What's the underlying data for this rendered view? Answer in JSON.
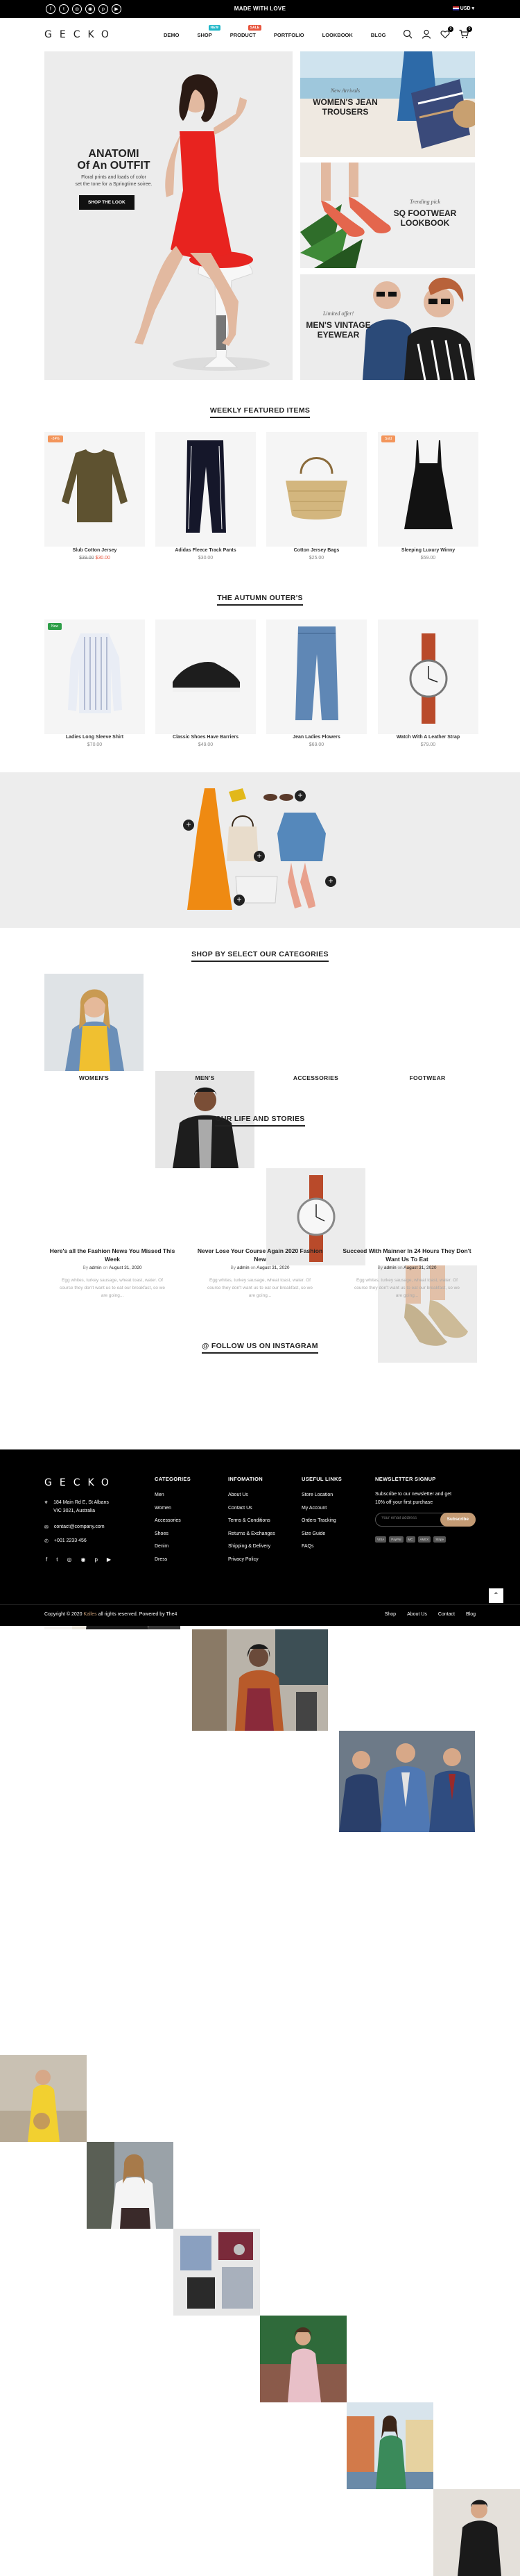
{
  "topbar": {
    "social_icons": [
      "facebook-icon",
      "twitter-icon",
      "instagram-icon",
      "dribbble-icon",
      "pinterest-icon",
      "youtube-icon"
    ],
    "social_glyphs": [
      "f",
      "t",
      "◎",
      "◉",
      "p",
      "▶"
    ],
    "message": "MADE WITH LOVE",
    "currency": "USD"
  },
  "header": {
    "logo": "GECKO",
    "nav": [
      {
        "label": "DEMO"
      },
      {
        "label": "SHOP",
        "badge": "NEW",
        "badge_color": "#1fb6c8"
      },
      {
        "label": "PRODUCT",
        "badge": "SALE",
        "badge_color": "#e8553e"
      },
      {
        "label": "PORTFOLIO"
      },
      {
        "label": "LOOKBOOK"
      },
      {
        "label": "BLOG"
      }
    ],
    "wishlist_count": "0",
    "cart_count": "0"
  },
  "hero": {
    "main_title_1": "ANATOMI",
    "main_title_2": "Of An OUTFIT",
    "main_desc_1": "Floral prints and loads of color",
    "main_desc_2": "set the tone for a Springtime soiree.",
    "main_button": "SHOP THE LOOK",
    "side": [
      {
        "pre": "New Arrivals",
        "title_1": "WOMEN'S JEAN",
        "title_2": "TROUSERS"
      },
      {
        "pre": "Trending pick",
        "title_1": "SQ FOOTWEAR",
        "title_2": "LOOKBOOK"
      },
      {
        "pre": "Limited offer!",
        "title_1": "MEN'S VINTAGE",
        "title_2": "EYEWEAR"
      }
    ]
  },
  "weekly": {
    "title": "WEEKLY FEATURED ITEMS",
    "items": [
      {
        "name": "Slub Cotton Jersey",
        "old_price": "$39.00",
        "price": "$30.00",
        "label": "-24%",
        "label_color": "#f3955b"
      },
      {
        "name": "Adidas Fleece Track Pants",
        "price": "$30.00"
      },
      {
        "name": "Cotton Jersey Bags",
        "price": "$25.00"
      },
      {
        "name": "Sleeping Luxury Winny",
        "price": "$59.00",
        "label": "Sold",
        "label_color": "#f3955b"
      }
    ]
  },
  "autumn": {
    "title": "THE AUTUMN OUTER'S",
    "items": [
      {
        "name": "Ladies Long Sleeve Shirt",
        "price": "$70.00",
        "label": "New",
        "label_color": "#2e9e48"
      },
      {
        "name": "Classic Shoes Have Barriers",
        "price": "$49.00"
      },
      {
        "name": "Jean Ladies Flowers",
        "price": "$69.00"
      },
      {
        "name": "Watch With A Leather Strap",
        "price": "$79.00"
      }
    ]
  },
  "categories": {
    "title": "SHOP BY SELECT OUR CATEGORIES",
    "items": [
      "WOMEN'S",
      "MEN'S",
      "ACCESSORIES",
      "FOOTWEAR"
    ]
  },
  "blog": {
    "title": "OUR LIFE AND STORIES",
    "by": "By",
    "on": "on",
    "posts": [
      {
        "title_1": "Here's all the Fashion News You Missed This",
        "title_2": "Week",
        "author": "admin",
        "date": "August 31, 2020",
        "ex_1": "Egg whites, turkey sausage, wheat toast, water. Of",
        "ex_2": "course they don't want us to eat our breakfast, so we",
        "ex_3": "are going..."
      },
      {
        "title_1": "Never Lose Your Course Again 2020 Fashion",
        "title_2": "New",
        "author": "admin",
        "date": "August 31, 2020",
        "ex_1": "Egg whites, turkey sausage, wheat toast, water. Of",
        "ex_2": "course they don't want us to eat our breakfast, so we",
        "ex_3": "are going..."
      },
      {
        "title_1": "Succeed With Mainner In 24 Hours They Don't",
        "title_2": "Want Us To Eat",
        "author": "admin",
        "date": "August 31, 2020",
        "ex_1": "Egg whites, turkey sausage, wheat toast, water. Of",
        "ex_2": "course they don't want us to eat our breakfast, so we",
        "ex_3": "are going..."
      }
    ]
  },
  "instagram": {
    "title": "@ FOLLOW US ON INSTAGRAM"
  },
  "footer": {
    "logo": "GECKO",
    "address_1": "184 Main Rd E, St Albans",
    "address_2": "VIC 3021, Australia",
    "email": "contact@company.com",
    "phone": "+001 2233 456",
    "col_categories": {
      "title": "CATEGORIES",
      "links": [
        "Men",
        "Women",
        "Accessories",
        "Shoes",
        "Denim",
        "Dress"
      ]
    },
    "col_info": {
      "title": "INFOMATION",
      "links": [
        "About Us",
        "Contact Us",
        "Terms & Conditions",
        "Returns & Exchanges",
        "Shipping & Delivery",
        "Privacy Policy"
      ]
    },
    "col_useful": {
      "title": "USEFUL LINKS",
      "links": [
        "Store Location",
        "My Account",
        "Orders Tracking",
        "Size Guide",
        "FAQs"
      ]
    },
    "newsletter": {
      "title": "NEWSLETTER SIGNUP",
      "desc_1": "Subscribe to our newsletter and get",
      "desc_2": "10% off your first purchase",
      "placeholder": "Your email address",
      "button": "Subscribe",
      "payments": [
        "VISA",
        "PayPal",
        "MC",
        "AMEX",
        "Stripe"
      ]
    }
  },
  "bottombar": {
    "copyright_pre": "Copyright © 2020",
    "brand": "Kalles",
    "copyright_post": "all rights reserved. Powered by The4",
    "links": [
      "Shop",
      "About Us",
      "Contact",
      "Blog"
    ]
  },
  "colors": {
    "accent": "#c39a73",
    "sale_red": "#e8553e",
    "dark": "#000000"
  }
}
